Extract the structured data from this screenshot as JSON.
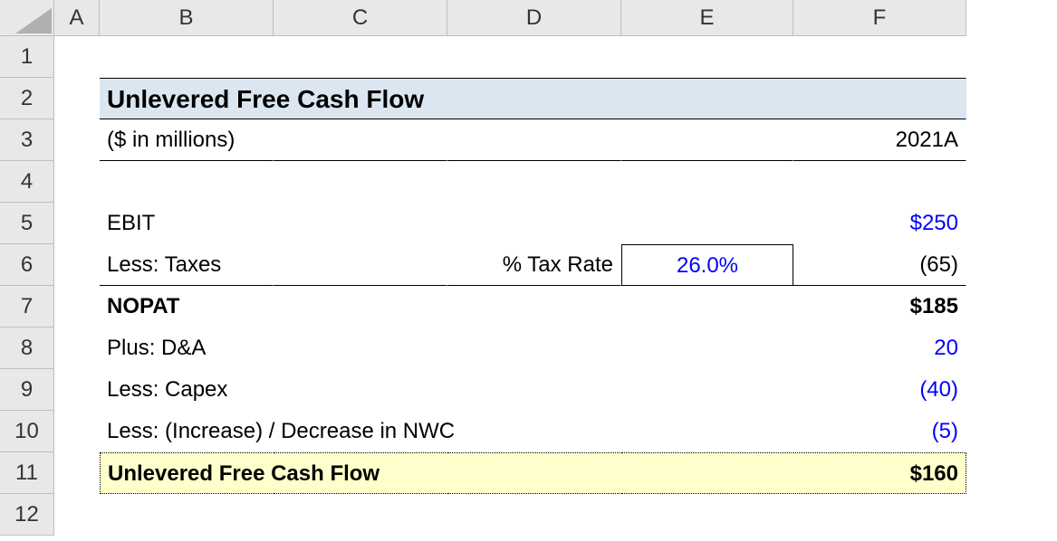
{
  "columns": [
    "A",
    "B",
    "C",
    "D",
    "E",
    "F"
  ],
  "rows": [
    "1",
    "2",
    "3",
    "4",
    "5",
    "6",
    "7",
    "8",
    "9",
    "10",
    "11",
    "12"
  ],
  "title": "Unlevered Free Cash Flow",
  "subtitle_units": "($ in millions)",
  "period": "2021A",
  "labels": {
    "ebit": "EBIT",
    "less_taxes": "Less: Taxes",
    "tax_rate_label": "% Tax Rate",
    "nopat": "NOPAT",
    "plus_da": "Plus: D&A",
    "less_capex": "Less: Capex",
    "less_nwc": "Less: (Increase) / Decrease in NWC",
    "ufcf": "Unlevered Free Cash Flow"
  },
  "values": {
    "ebit": "$250",
    "tax_rate": "26.0%",
    "taxes": "(65)",
    "nopat": "$185",
    "da": "20",
    "capex": "(40)",
    "nwc": "(5)",
    "ufcf": "$160"
  }
}
